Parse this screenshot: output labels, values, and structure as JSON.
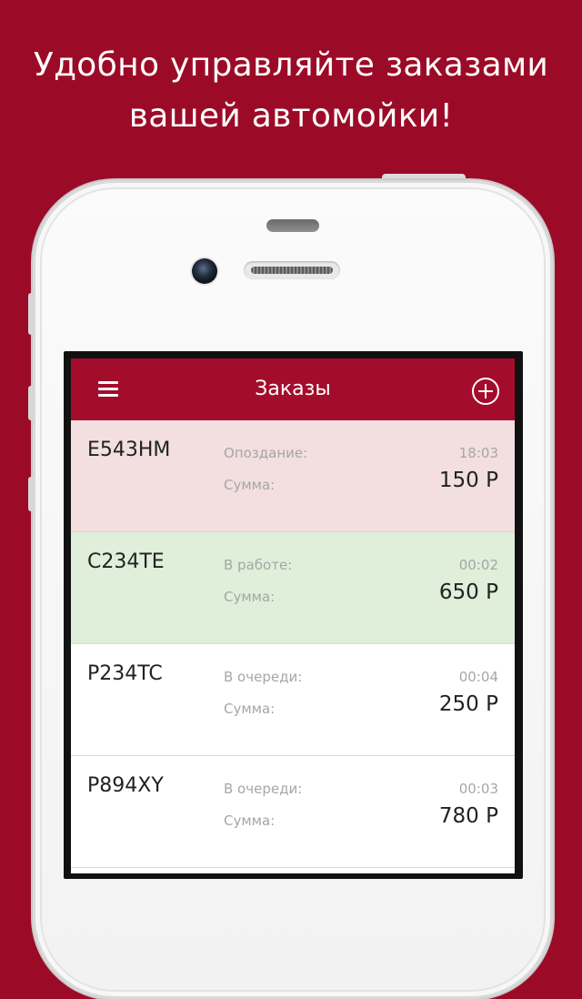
{
  "headline": {
    "line1": "Удобно управляйте заказами",
    "line2": "вашей автомойки!"
  },
  "app": {
    "title": "Заказы",
    "menu_icon": "hamburger-menu-icon",
    "add_icon": "plus-circle-icon",
    "accent_color": "#a30d2b"
  },
  "orders": [
    {
      "plate": "E543HM",
      "status_label": "Опоздание:",
      "time": "18:03",
      "sum_label": "Сумма:",
      "amount": "150 Р",
      "state": "late",
      "bg": "#f3dfe0"
    },
    {
      "plate": "C234TE",
      "status_label": "В работе:",
      "time": "00:02",
      "sum_label": "Сумма:",
      "amount": "650 Р",
      "state": "work",
      "bg": "#dfefd9"
    },
    {
      "plate": "P234TC",
      "status_label": "В очереди:",
      "time": "00:04",
      "sum_label": "Сумма:",
      "amount": "250 Р",
      "state": "queue",
      "bg": "#ffffff"
    },
    {
      "plate": "P894XY",
      "status_label": "В очереди:",
      "time": "00:03",
      "sum_label": "Сумма:",
      "amount": "780 Р",
      "state": "queue",
      "bg": "#ffffff"
    }
  ]
}
